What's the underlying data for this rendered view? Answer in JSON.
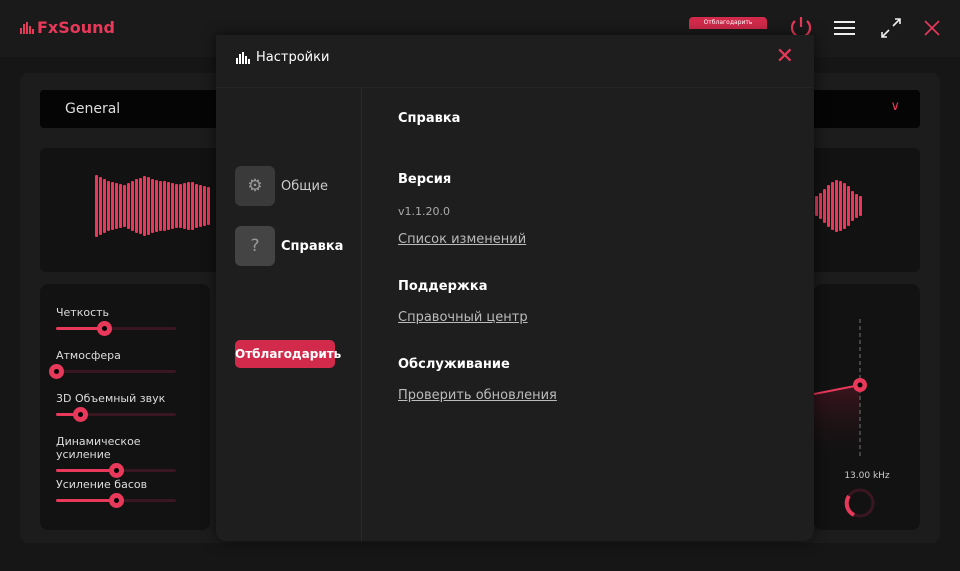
{
  "app": {
    "name": "FxSound",
    "donate_label": "Отблагодарить",
    "accent": "#e8395a"
  },
  "preset": {
    "selected": "General"
  },
  "effects": [
    {
      "label": "Четкость",
      "value": 0.4
    },
    {
      "label": "Атмосфера",
      "value": 0
    },
    {
      "label": "3D Объемный звук",
      "value": 0.2
    },
    {
      "label": "Динамическое усиление",
      "value": 0.5
    },
    {
      "label": "Усиление басов",
      "value": 0.5
    }
  ],
  "eq": {
    "freq_label": "13.00 kHz"
  },
  "settings": {
    "title": "Настройки",
    "nav": [
      {
        "label": "Общие",
        "icon": "gear-icon"
      },
      {
        "label": "Справка",
        "icon": "help-icon"
      }
    ],
    "donate_label": "Отблагодарить",
    "section_title": "Справка",
    "version_heading": "Версия",
    "version": "v1.1.20.0",
    "changelog_link": "Список изменений",
    "support_heading": "Поддержка",
    "help_center_link": "Справочный центр",
    "maintenance_heading": "Обслуживание",
    "check_updates_link": "Проверить обновления"
  }
}
